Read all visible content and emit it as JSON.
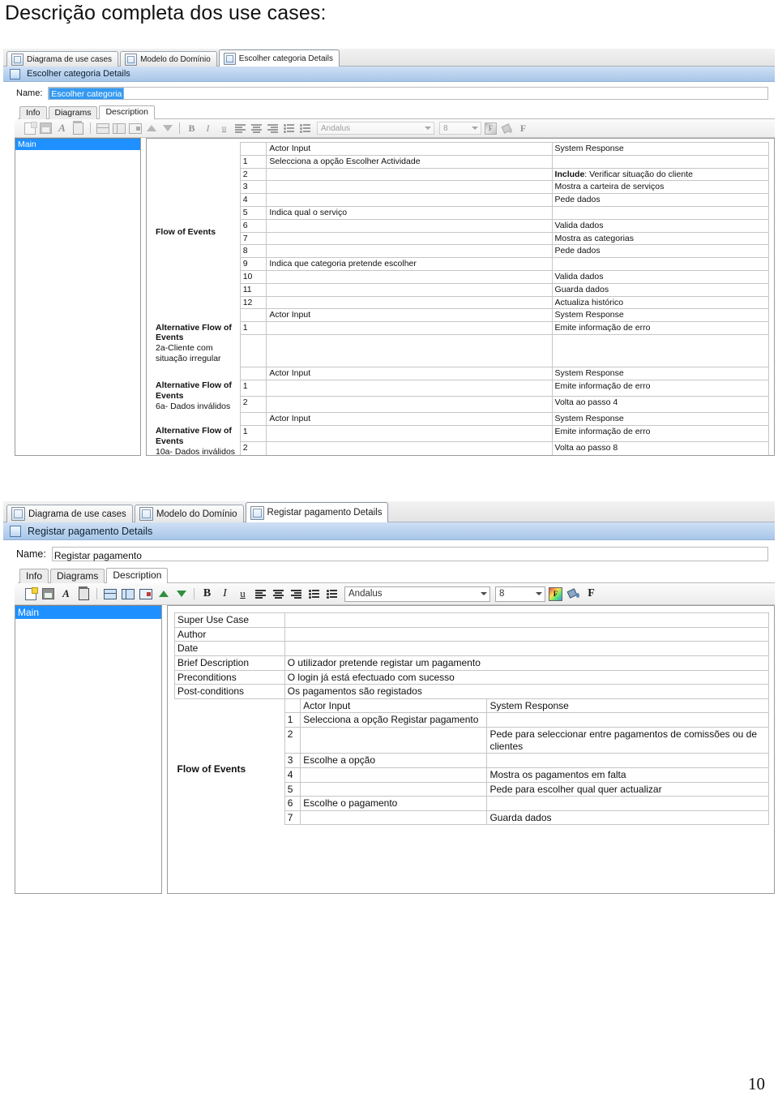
{
  "page": {
    "heading": "Descrição completa dos use cases:",
    "number": "10"
  },
  "panels": [
    {
      "id": "escolher-categoria",
      "tabs": [
        {
          "label": "Diagrama de use cases",
          "icon": "diagram-icon",
          "active": false
        },
        {
          "label": "Modelo do Domínio",
          "icon": "domain-model-icon",
          "active": false
        },
        {
          "label": "Escolher categoria Details",
          "icon": "details-doc-icon",
          "active": true
        }
      ],
      "title_bar": {
        "title": "Escolher categoria Details",
        "icon": "window-icon"
      },
      "name_field": {
        "label": "Name:",
        "value": "Escolher categoria",
        "selected": true
      },
      "inner_tabs": [
        {
          "label": "Info",
          "active": false
        },
        {
          "label": "Diagrams",
          "active": false
        },
        {
          "label": "Description",
          "active": true
        }
      ],
      "toolbar": {
        "enabled": false,
        "buttons": [
          {
            "name": "new-document-icon",
            "type": "newdoc"
          },
          {
            "name": "save-icon",
            "type": "save"
          },
          {
            "name": "format-painter-icon",
            "type": "A"
          },
          {
            "name": "delete-icon",
            "type": "trash"
          },
          {
            "name": "insert-column-icon",
            "type": "tbl"
          },
          {
            "name": "insert-table-icon",
            "type": "row"
          },
          {
            "name": "insert-step-icon",
            "type": "indent"
          },
          {
            "name": "move-up-icon",
            "type": "up"
          },
          {
            "name": "move-down-icon",
            "type": "down"
          },
          {
            "name": "bold-button",
            "type": "text",
            "label": "B"
          },
          {
            "name": "italic-button",
            "type": "text-ital",
            "label": "I"
          },
          {
            "name": "underline-button",
            "type": "text-und",
            "label": "u"
          },
          {
            "name": "align-left-icon",
            "type": "align-left"
          },
          {
            "name": "align-center-icon",
            "type": "align-center"
          },
          {
            "name": "align-right-icon",
            "type": "align-right"
          },
          {
            "name": "numbered-list-icon",
            "type": "numlist"
          },
          {
            "name": "bulleted-list-icon",
            "type": "bullist"
          }
        ],
        "font_family": "Andalus",
        "font_size": "8",
        "font_color_label": "F",
        "format-button-label": "F"
      },
      "tree": {
        "items": [
          {
            "label": "Main",
            "selected": true
          }
        ]
      },
      "doc": {
        "columns": {
          "actor": "Actor Input",
          "system": "System Response"
        },
        "sections": [
          {
            "label": "Flow of Events",
            "sub_label": "",
            "rows": [
              {
                "n": "1",
                "actor": "Selecciona a opção Escolher Actividade",
                "system": ""
              },
              {
                "n": "2",
                "actor": "",
                "system": "Include: Verificar situação do cliente",
                "system_bold_prefix": "Include"
              },
              {
                "n": "3",
                "actor": "",
                "system": "Mostra a carteira de serviços"
              },
              {
                "n": "4",
                "actor": "",
                "system": "Pede dados"
              },
              {
                "n": "5",
                "actor": "Indica qual o serviço",
                "system": ""
              },
              {
                "n": "6",
                "actor": "",
                "system": "Valida dados"
              },
              {
                "n": "7",
                "actor": "",
                "system": "Mostra as categorias"
              },
              {
                "n": "8",
                "actor": "",
                "system": "Pede dados"
              },
              {
                "n": "9",
                "actor": "Indica que categoria pretende escolher",
                "system": ""
              },
              {
                "n": "10",
                "actor": "",
                "system": "Valida dados"
              },
              {
                "n": "11",
                "actor": "",
                "system": "Guarda dados"
              },
              {
                "n": "12",
                "actor": "",
                "system": "Actualiza histórico"
              }
            ]
          },
          {
            "label": "Alternative Flow of Events",
            "sub_label": "2a-Cliente com situação irregular",
            "rows": [
              {
                "n": "1",
                "actor": "",
                "system": "Emite informação de erro"
              }
            ]
          },
          {
            "label": "Alternative Flow of Events",
            "sub_label": "6a- Dados inválidos",
            "rows": [
              {
                "n": "1",
                "actor": "",
                "system": "Emite informação de erro"
              },
              {
                "n": "2",
                "actor": "",
                "system": "Volta ao passo 4"
              }
            ]
          },
          {
            "label": "Alternative Flow of Events",
            "sub_label": "10a- Dados inválidos",
            "rows": [
              {
                "n": "1",
                "actor": "",
                "system": "Emite informação de erro"
              },
              {
                "n": "2",
                "actor": "",
                "system": "Volta ao passo 8"
              }
            ]
          }
        ]
      }
    },
    {
      "id": "registar-pagamento",
      "tabs": [
        {
          "label": "Diagrama de use cases",
          "icon": "diagram-icon",
          "active": false
        },
        {
          "label": "Modelo do Domínio",
          "icon": "domain-model-icon",
          "active": false
        },
        {
          "label": "Registar pagamento Details",
          "icon": "details-doc-icon",
          "active": true
        }
      ],
      "title_bar": {
        "title": "Registar pagamento Details",
        "icon": "window-icon"
      },
      "name_field": {
        "label": "Name:",
        "value": "Registar pagamento",
        "selected": false
      },
      "inner_tabs": [
        {
          "label": "Info",
          "active": false
        },
        {
          "label": "Diagrams",
          "active": false
        },
        {
          "label": "Description",
          "active": true
        }
      ],
      "toolbar": {
        "enabled": true,
        "buttons": [
          {
            "name": "new-document-icon",
            "type": "newdoc"
          },
          {
            "name": "save-icon",
            "type": "save"
          },
          {
            "name": "format-painter-icon",
            "type": "A"
          },
          {
            "name": "delete-icon",
            "type": "trash"
          },
          {
            "name": "insert-column-icon",
            "type": "tbl"
          },
          {
            "name": "insert-table-icon",
            "type": "row"
          },
          {
            "name": "insert-step-icon",
            "type": "indent"
          },
          {
            "name": "move-up-icon",
            "type": "up"
          },
          {
            "name": "move-down-icon",
            "type": "down"
          },
          {
            "name": "bold-button",
            "type": "text",
            "label": "B"
          },
          {
            "name": "italic-button",
            "type": "text-ital",
            "label": "I"
          },
          {
            "name": "underline-button",
            "type": "text-und",
            "label": "u"
          },
          {
            "name": "align-left-icon",
            "type": "align-left"
          },
          {
            "name": "align-center-icon",
            "type": "align-center"
          },
          {
            "name": "align-right-icon",
            "type": "align-right"
          },
          {
            "name": "numbered-list-icon",
            "type": "numlist"
          },
          {
            "name": "bulleted-list-icon",
            "type": "bullist"
          }
        ],
        "font_family": "Andalus",
        "font_size": "8",
        "font_color_label": "F",
        "format-button-label": "F"
      },
      "tree": {
        "items": [
          {
            "label": "Main",
            "selected": true
          }
        ]
      },
      "doc": {
        "columns": {
          "actor": "Actor Input",
          "system": "System Response"
        },
        "info_rows": [
          {
            "label": "Super Use Case",
            "value": ""
          },
          {
            "label": "Author",
            "value": ""
          },
          {
            "label": "Date",
            "value": ""
          },
          {
            "label": "Brief Description",
            "value": "O utilizador pretende registar um pagamento"
          },
          {
            "label": "Preconditions",
            "value": "O login já está efectuado com sucesso"
          },
          {
            "label": "Post-conditions",
            "value": "Os pagamentos são registados"
          }
        ],
        "sections": [
          {
            "label": "Flow of Events",
            "sub_label": "",
            "rows": [
              {
                "n": "1",
                "actor": "Selecciona a opção Registar pagamento",
                "system": ""
              },
              {
                "n": "2",
                "actor": "",
                "system": "Pede para seleccionar entre pagamentos de comissões ou de clientes"
              },
              {
                "n": "3",
                "actor": "Escolhe a opção",
                "system": ""
              },
              {
                "n": "4",
                "actor": "",
                "system": "Mostra os pagamentos em falta"
              },
              {
                "n": "5",
                "actor": "",
                "system": "Pede para escolher qual quer actualizar"
              },
              {
                "n": "6",
                "actor": "Escolhe o pagamento",
                "system": ""
              },
              {
                "n": "7",
                "actor": "",
                "system": "Guarda dados"
              }
            ]
          }
        ]
      }
    }
  ]
}
